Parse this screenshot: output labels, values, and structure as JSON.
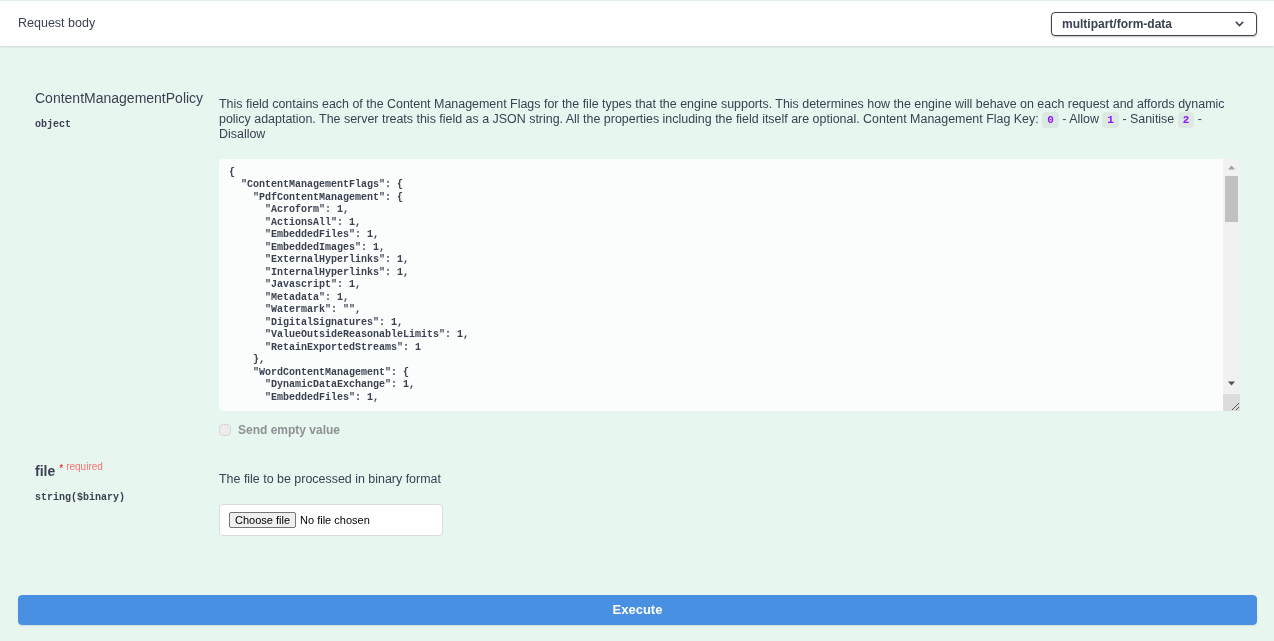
{
  "header": {
    "title": "Request body",
    "content_type": "multipart/form-data"
  },
  "parameters": [
    {
      "kind": "json",
      "name": "ContentManagementPolicy",
      "required": false,
      "type": "object",
      "description": [
        {
          "kind": "text",
          "text": "This field contains each of the Content Management Flags for the file types that the engine supports. This determines how the engine will behave on each request and affords dynamic policy adaptation. The server treats this field as a JSON string. All the properties including the field itself are optional. Content Management Flag Key: "
        },
        {
          "kind": "code",
          "text": "0"
        },
        {
          "kind": "text",
          "text": " - Allow "
        },
        {
          "kind": "code",
          "text": "1"
        },
        {
          "kind": "text",
          "text": " - Sanitise "
        },
        {
          "kind": "code",
          "text": "2"
        },
        {
          "kind": "text",
          "text": " - Disallow"
        }
      ],
      "value": "{\n  \"ContentManagementFlags\": {\n    \"PdfContentManagement\": {\n      \"Acroform\": 1,\n      \"ActionsAll\": 1,\n      \"EmbeddedFiles\": 1,\n      \"EmbeddedImages\": 1,\n      \"ExternalHyperlinks\": 1,\n      \"InternalHyperlinks\": 1,\n      \"Javascript\": 1,\n      \"Metadata\": 1,\n      \"Watermark\": \"\",\n      \"DigitalSignatures\": 1,\n      \"ValueOutsideReasonableLimits\": 1,\n      \"RetainExportedStreams\": 1\n    },\n    \"WordContentManagement\": {\n      \"DynamicDataExchange\": 1,\n      \"EmbeddedFiles\": 1,",
      "send_empty_value": {
        "label": "Send empty value",
        "checked": false,
        "disabled": true
      }
    },
    {
      "kind": "file",
      "name": "file",
      "required": true,
      "required_star": "*",
      "required_label": "required",
      "type": "string($binary)",
      "description": [
        {
          "kind": "text",
          "text": "The file to be processed in binary format"
        }
      ],
      "file_input": {
        "button": "Choose file",
        "status": "No file chosen"
      }
    }
  ],
  "execute_button": {
    "label": "Execute"
  }
}
